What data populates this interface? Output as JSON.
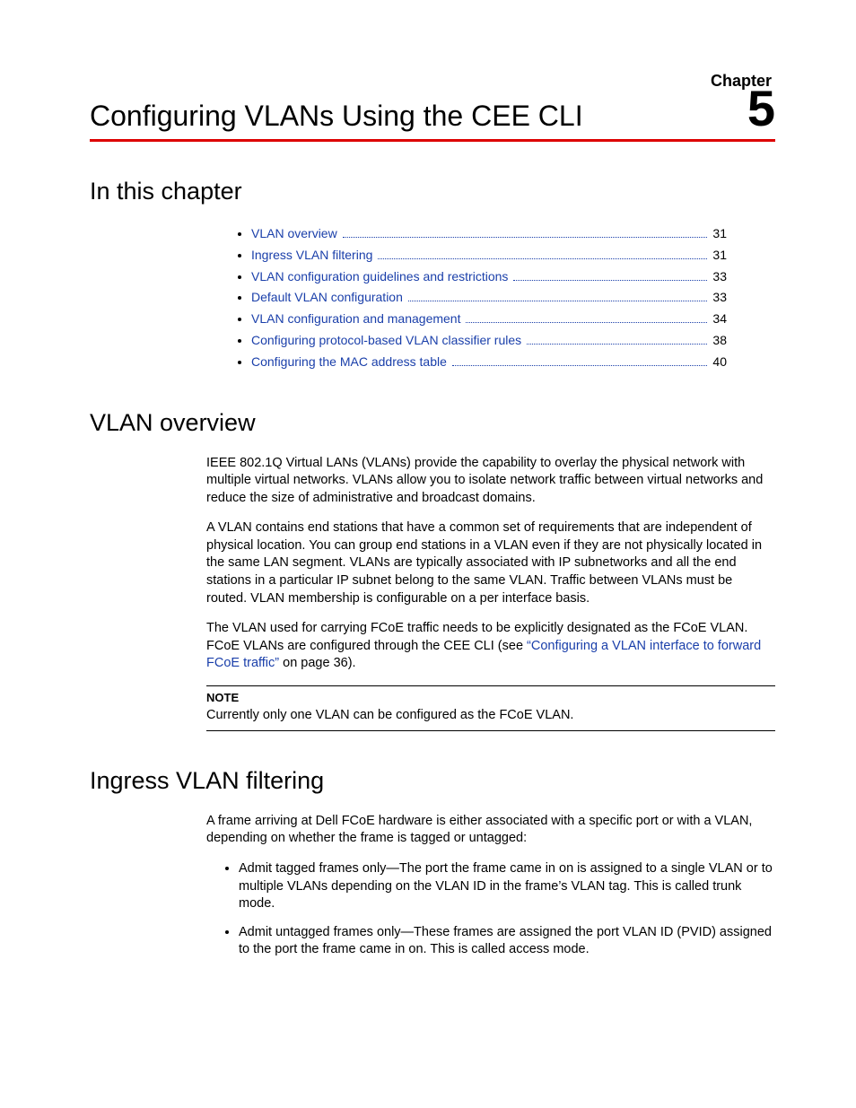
{
  "header": {
    "chapter_label": "Chapter",
    "chapter_number": "5",
    "title": "Configuring VLANs Using the CEE CLI"
  },
  "sections": {
    "in_this_chapter": "In this chapter",
    "vlan_overview": "VLAN overview",
    "ingress_filtering": "Ingress VLAN filtering"
  },
  "toc": [
    {
      "label": "VLAN overview",
      "page": "31"
    },
    {
      "label": "Ingress VLAN filtering",
      "page": "31"
    },
    {
      "label": "VLAN configuration guidelines and restrictions",
      "page": "33"
    },
    {
      "label": "Default VLAN configuration",
      "page": "33"
    },
    {
      "label": "VLAN configuration and management",
      "page": "34"
    },
    {
      "label": "Configuring protocol-based VLAN classifier rules",
      "page": "38"
    },
    {
      "label": "Configuring the MAC address table",
      "page": "40"
    }
  ],
  "overview": {
    "p1": "IEEE 802.1Q Virtual LANs (VLANs) provide the capability to overlay the physical network with multiple virtual networks. VLANs allow you to isolate network traffic between virtual networks and reduce the size of administrative and broadcast domains.",
    "p2": "A VLAN contains end stations that have a common set of requirements that are independent of physical location. You can group end stations in a VLAN even if they are not physically located in the same LAN segment. VLANs are typically associated with IP subnetworks and all the end stations in a particular IP subnet belong to the same VLAN. Traffic between VLANs must be routed. VLAN membership is configurable on a per interface basis.",
    "p3_prefix": "The VLAN used for carrying FCoE traffic needs to be explicitly designated as the FCoE VLAN. FCoE VLANs are configured through the CEE CLI (see ",
    "p3_link": "“Configuring a VLAN interface to forward FCoE traffic”",
    "p3_suffix": " on page 36).",
    "note_label": "NOTE",
    "note_text": "Currently only one VLAN can be configured as the FCoE VLAN."
  },
  "ingress": {
    "intro": "A frame arriving at Dell FCoE hardware is either associated with a specific port or with a VLAN, depending on whether the frame is tagged or untagged:",
    "bullets": [
      "Admit tagged frames only—The port the frame came in on is assigned to a single VLAN or to multiple VLANs depending on the VLAN ID in the frame’s VLAN tag. This is called trunk mode.",
      "Admit untagged frames only—These frames are assigned the port VLAN ID (PVID) assigned to the port the frame came in on. This is called access mode."
    ]
  }
}
